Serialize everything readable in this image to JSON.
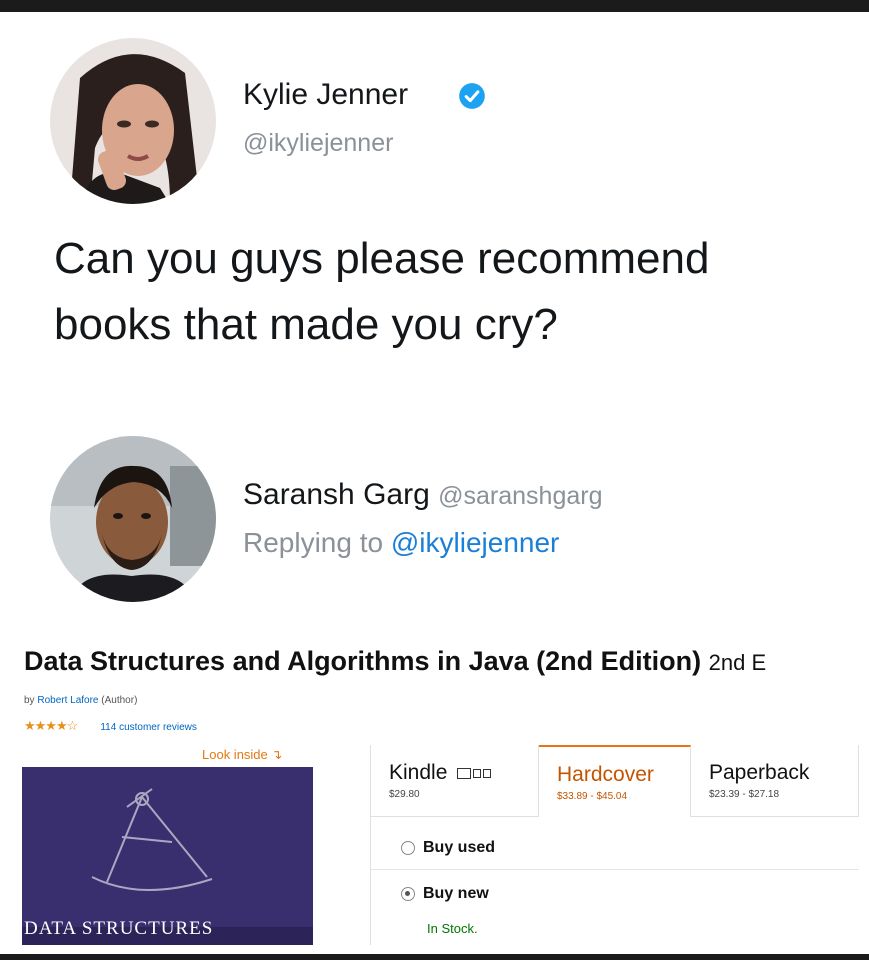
{
  "tweet": {
    "author_name": "Kylie Jenner",
    "author_handle": "@ikyliejenner",
    "text_line1": "Can you guys please recommend",
    "text_line2": "books that made you cry?"
  },
  "reply": {
    "author_name": "Saransh Garg",
    "author_handle": "@saranshgarg",
    "replying_prefix": "Replying to",
    "replying_to": "@ikyliejenner"
  },
  "product": {
    "title": "Data Structures and Algorithms in Java (2nd Edition)",
    "edition": "2nd E",
    "by_prefix": "by",
    "author": "Robert Lafore",
    "author_role": "(Author)",
    "rating_stars": "★★★★☆",
    "reviews": "114 customer reviews",
    "look_inside": "Look inside",
    "cover_title": "DATA STRUCTURES",
    "formats": [
      {
        "name": "Kindle",
        "price": "$29.80"
      },
      {
        "name": "Hardcover",
        "price": "$33.89 - $45.04"
      },
      {
        "name": "Paperback",
        "price": "$23.39 - $27.18"
      }
    ],
    "buy_used": "Buy used",
    "buy_new": "Buy new",
    "stock_status": "In Stock."
  },
  "colors": {
    "verified_blue": "#1da1f2",
    "link_blue": "#1c7fd6",
    "amazon_orange": "#e47911",
    "cover_purple": "#3a2f6e"
  }
}
